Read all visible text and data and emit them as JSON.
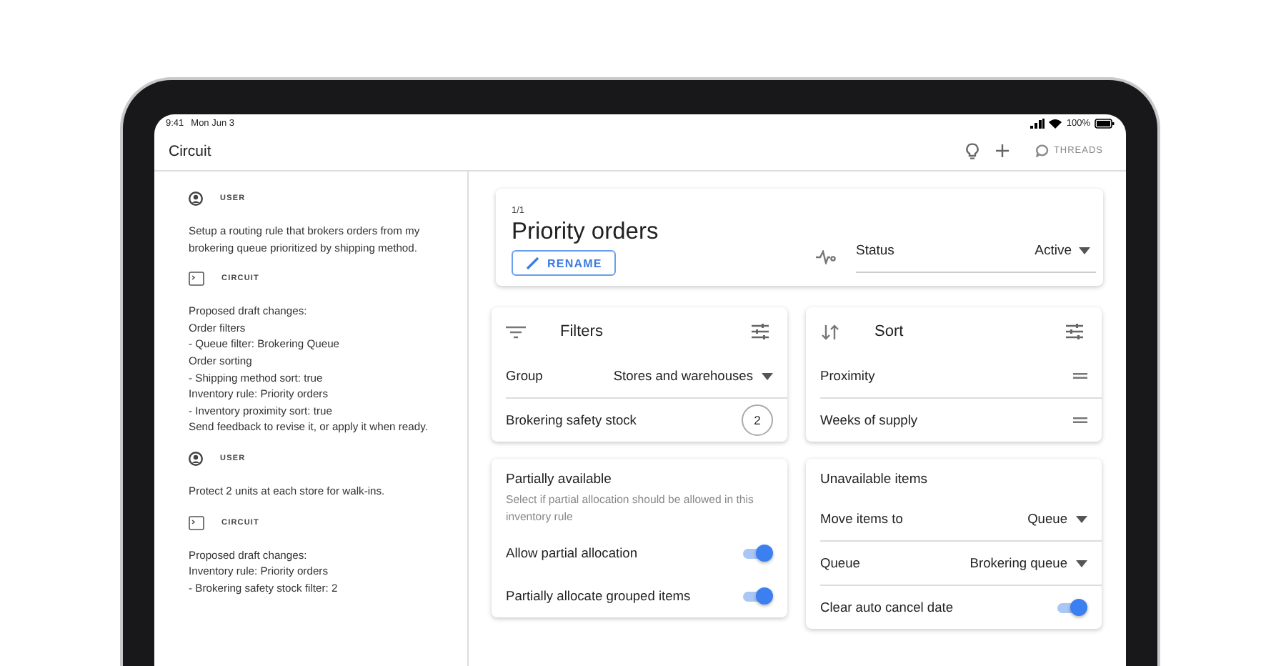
{
  "status_bar": {
    "time": "9:41",
    "date": "Mon Jun 3",
    "battery": "100%"
  },
  "app_bar": {
    "title": "Circuit",
    "threads_label": "THREADS"
  },
  "messages": [
    {
      "kind": "user",
      "role": "USER",
      "lines": [
        "Setup a routing rule that brokers orders from my brokering queue prioritized by shipping method."
      ]
    },
    {
      "kind": "assistant",
      "role": "CIRCUIT",
      "lines": [
        "Proposed draft changes:",
        "Order filters",
        "- Queue filter: Brokering Queue",
        "Order sorting",
        "- Shipping method sort: true",
        "Inventory rule: Priority orders",
        "- Inventory proximity sort: true",
        "Send feedback to revise it, or apply it when ready."
      ]
    },
    {
      "kind": "user",
      "role": "USER",
      "lines": [
        "Protect 2 units at each store for walk-ins."
      ]
    },
    {
      "kind": "assistant",
      "role": "CIRCUIT",
      "lines": [
        "Proposed draft changes:",
        "Inventory rule: Priority orders",
        "- Brokering safety stock filter: 2"
      ]
    }
  ],
  "rule": {
    "counter": "1/1",
    "title": "Priority orders",
    "rename_label": "RENAME",
    "status_label": "Status",
    "status_value": "Active"
  },
  "filters": {
    "title": "Filters",
    "rows": [
      {
        "kind": "select",
        "label": "Group",
        "value": "Stores and warehouses"
      },
      {
        "kind": "count",
        "label": "Brokering safety stock",
        "value": "2"
      }
    ]
  },
  "sort": {
    "title": "Sort",
    "rows": [
      {
        "label": "Proximity"
      },
      {
        "label": "Weeks of supply"
      }
    ]
  },
  "partial": {
    "title": "Partially available",
    "description": "Select if partial allocation should be allowed in this inventory rule",
    "toggles": [
      {
        "label": "Allow partial allocation",
        "on": true
      },
      {
        "label": "Partially allocate grouped items",
        "on": true
      }
    ]
  },
  "unavailable": {
    "title": "Unavailable items",
    "rows": [
      {
        "kind": "select",
        "label": "Move items to",
        "value": "Queue"
      },
      {
        "kind": "select",
        "label": "Queue",
        "value": "Brokering queue"
      },
      {
        "kind": "toggle",
        "label": "Clear auto cancel date",
        "on": true
      }
    ]
  }
}
